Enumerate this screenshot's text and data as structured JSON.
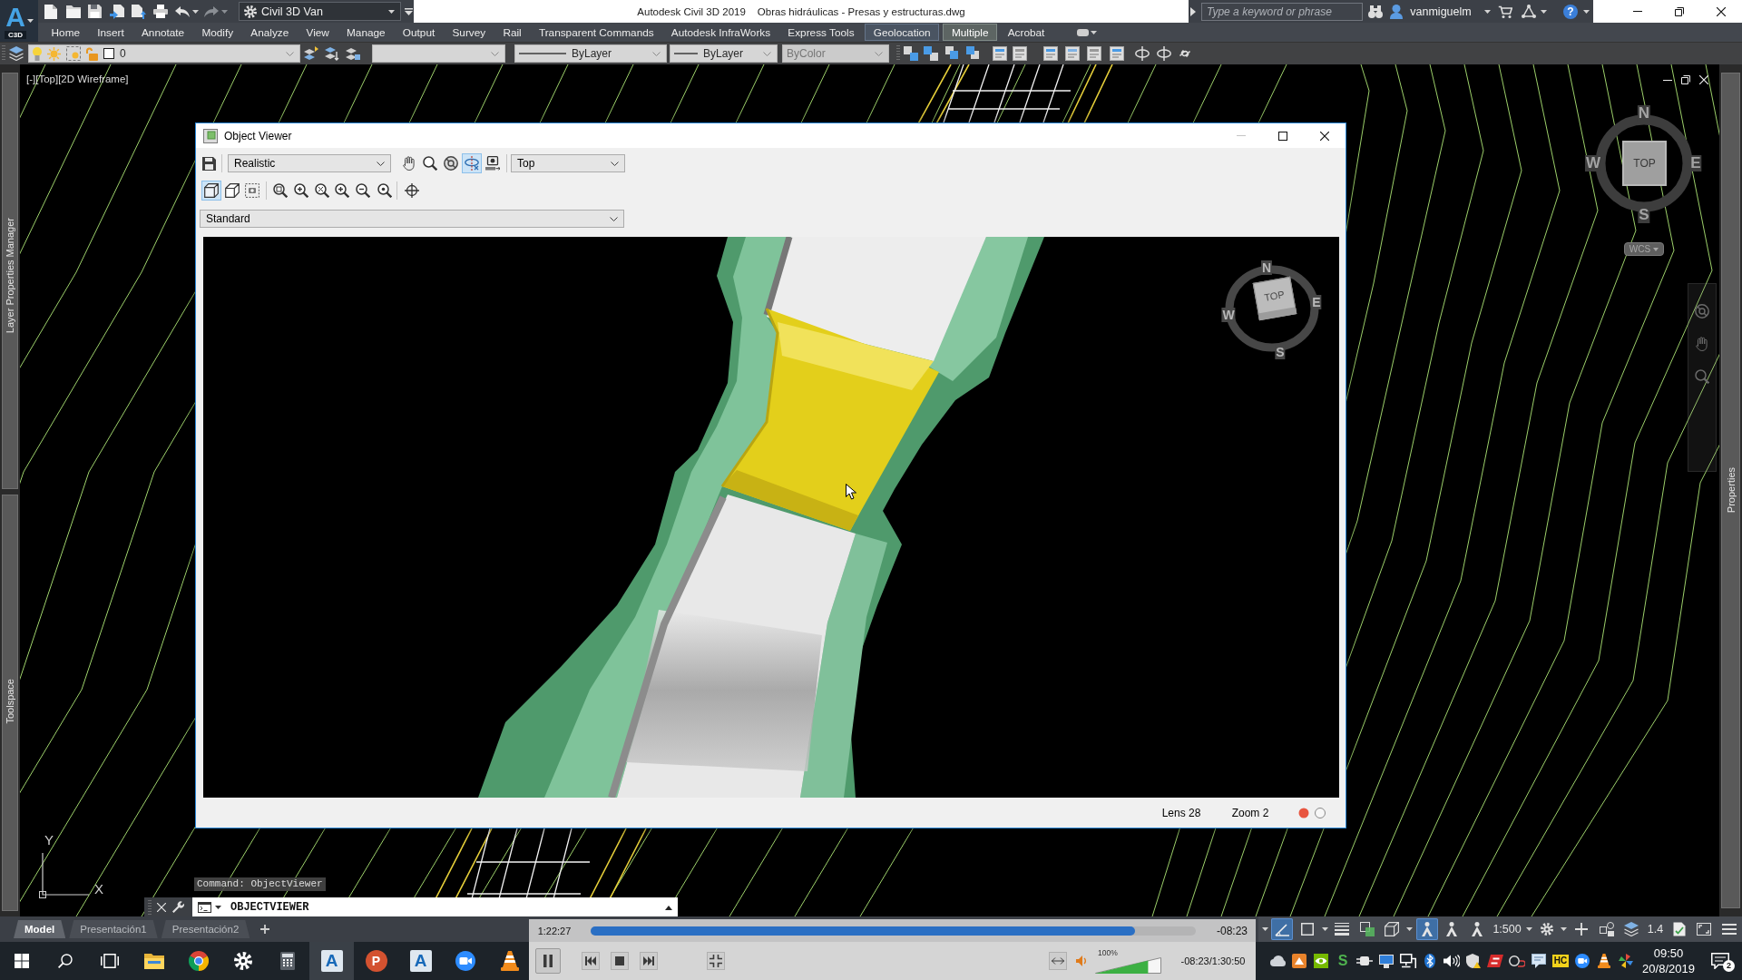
{
  "title_bar": {
    "app_button": {
      "letter": "A",
      "label": "C3D"
    },
    "workspace": "Civil 3D Van",
    "app_title": "Autodesk Civil 3D 2019",
    "document": "Obras hidráulicas - Presas y estructuras.dwg",
    "search": {
      "placeholder": "Type a keyword or phrase"
    },
    "user": "vanmiguelm",
    "help": "?"
  },
  "ribbon_tabs": [
    {
      "label": "Home",
      "kind": "standard",
      "selected": false
    },
    {
      "label": "Insert",
      "kind": "standard",
      "selected": false
    },
    {
      "label": "Annotate",
      "kind": "standard",
      "selected": false
    },
    {
      "label": "Modify",
      "kind": "standard",
      "selected": false
    },
    {
      "label": "Analyze",
      "kind": "standard",
      "selected": false
    },
    {
      "label": "View",
      "kind": "standard",
      "selected": false
    },
    {
      "label": "Manage",
      "kind": "standard",
      "selected": false
    },
    {
      "label": "Output",
      "kind": "standard",
      "selected": false
    },
    {
      "label": "Survey",
      "kind": "standard",
      "selected": false
    },
    {
      "label": "Rail",
      "kind": "standard",
      "selected": false
    },
    {
      "label": "Transparent Commands",
      "kind": "standard",
      "selected": false
    },
    {
      "label": "Autodesk InfraWorks",
      "kind": "standard",
      "selected": false
    },
    {
      "label": "Express Tools",
      "kind": "standard",
      "selected": false
    },
    {
      "label": "Geolocation",
      "kind": "contextual",
      "selected": false
    },
    {
      "label": "Multiple",
      "kind": "contextual",
      "selected": true
    },
    {
      "label": "Acrobat",
      "kind": "standard",
      "selected": false
    }
  ],
  "properties_toolbar": {
    "layer": {
      "value": "0",
      "disabled": false
    },
    "linetype": {
      "value": "ByLayer",
      "disabled": false
    },
    "lineweight": {
      "value": "ByLayer",
      "disabled": false
    },
    "plot_style": {
      "value": "ByColor",
      "disabled": true
    }
  },
  "drawing": {
    "viewport_label": "[-][Top][2D Wireframe]",
    "left_palettes": [
      "Layer Properties Manager",
      "Toolspace"
    ],
    "right_palette": "Properties",
    "viewcube": {
      "face": "TOP",
      "north": "N",
      "east": "E",
      "south": "S",
      "west": "W",
      "ucs_menu": "WCS"
    },
    "ucs_icon": {
      "y": "Y",
      "x": "X"
    }
  },
  "object_viewer": {
    "title": "Object Viewer",
    "visual_style": "Realistic",
    "view_tools": [
      {
        "kind": "hand",
        "selected": false
      },
      {
        "kind": "magnifier",
        "selected": false
      },
      {
        "kind": "wheel",
        "selected": false
      },
      {
        "kind": "orbit",
        "selected": true
      },
      {
        "kind": "camera",
        "selected": false
      }
    ],
    "view": "Top",
    "projection_tools": [
      {
        "kind": "parallel",
        "selected": true
      },
      {
        "kind": "perspective",
        "selected": false
      },
      {
        "kind": "camera_frame",
        "selected": false
      }
    ],
    "named_view": "Standard",
    "viewcube": {
      "face": "TOP",
      "north": "N",
      "east": "E",
      "south": "S",
      "west": "W"
    },
    "status": {
      "lens": "Lens 28",
      "zoom": "Zoom 2"
    }
  },
  "command_line": {
    "history": "Command: ObjectViewer",
    "input": "OBJECTVIEWER"
  },
  "layout_tabs": [
    {
      "label": "Model",
      "selected": true
    },
    {
      "label": "Presentación1",
      "selected": false
    },
    {
      "label": "Presentación2",
      "selected": false
    }
  ],
  "status_bar": {
    "items": [
      {
        "kind": "polar",
        "on": true
      },
      {
        "kind": "isodraft",
        "on": false
      },
      {
        "kind": "lineweight",
        "on": false
      },
      {
        "kind": "transparency",
        "on": false
      },
      {
        "kind": "cycling",
        "on": false
      },
      {
        "kind": "annotation",
        "on": true
      },
      {
        "kind": "annotation",
        "on": false
      },
      {
        "kind": "annotation",
        "on": false
      },
      {
        "kind": "scale",
        "text": "1:500"
      },
      {
        "kind": "workspace",
        "on": false
      },
      {
        "kind": "plus",
        "on": false
      },
      {
        "kind": "isolate",
        "on": false
      },
      {
        "kind": "layers",
        "on": false
      },
      {
        "kind": "readout",
        "text": "1.4"
      },
      {
        "kind": "units",
        "on": false
      },
      {
        "kind": "fullscreen",
        "on": false
      },
      {
        "kind": "menu",
        "on": false
      }
    ]
  },
  "video_player": {
    "elapsed": "1:22:27",
    "progress": {
      "level": 0.9
    },
    "remaining": "-08:23",
    "playing": true,
    "volume": {
      "label": "100%",
      "level": 0.8
    },
    "time": "-08:23/1:30:50"
  },
  "taskbar": {
    "apps": [
      {
        "kind": "explorer",
        "active": false
      },
      {
        "kind": "chrome",
        "active": false
      },
      {
        "kind": "settings",
        "active": false
      },
      {
        "kind": "calculator",
        "active": false
      },
      {
        "kind": "letter_tile",
        "letter": "A",
        "active": true
      },
      {
        "kind": "letter_disc",
        "letter": "P",
        "active": false
      },
      {
        "kind": "letter_tile",
        "letter": "A",
        "active": false
      },
      {
        "kind": "zoom",
        "active": false
      },
      {
        "kind": "vlc",
        "active": false
      }
    ],
    "tray": {
      "letter_icon": "S",
      "badge_icon": "HC"
    },
    "clock": {
      "time": "09:50",
      "date": "20/8/2019"
    },
    "notifications": "2"
  }
}
